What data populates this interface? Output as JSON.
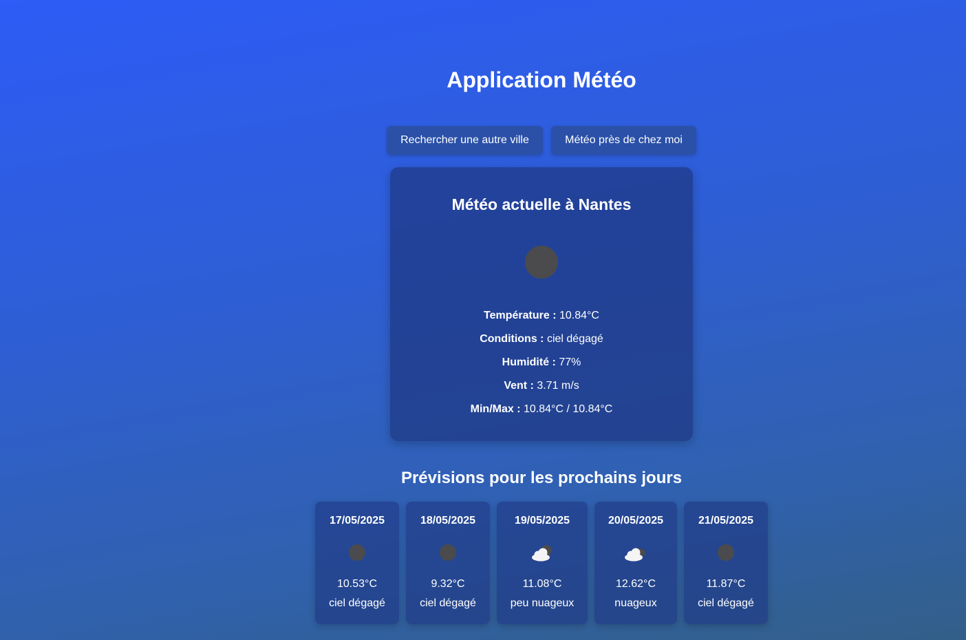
{
  "app": {
    "title": "Application Météo"
  },
  "actions": {
    "search_label": "Rechercher une autre ville",
    "near_label": "Météo près de chez moi"
  },
  "current": {
    "title": "Météo actuelle à Nantes",
    "icon": "clear-sky-icon",
    "details": [
      {
        "label": "Température :",
        "value": "10.84°C"
      },
      {
        "label": "Conditions :",
        "value": "ciel dégagé"
      },
      {
        "label": "Humidité :",
        "value": "77%"
      },
      {
        "label": "Vent :",
        "value": "3.71 m/s"
      },
      {
        "label": "Min/Max :",
        "value": "10.84°C / 10.84°C"
      }
    ]
  },
  "forecast": {
    "title": "Prévisions pour les prochains jours",
    "days": [
      {
        "date": "17/05/2025",
        "temp": "10.53°C",
        "desc": "ciel dégagé",
        "icon": "clear-sky-icon"
      },
      {
        "date": "18/05/2025",
        "temp": "9.32°C",
        "desc": "ciel dégagé",
        "icon": "clear-sky-icon"
      },
      {
        "date": "19/05/2025",
        "temp": "11.08°C",
        "desc": "peu nuageux",
        "icon": "few-clouds-icon"
      },
      {
        "date": "20/05/2025",
        "temp": "12.62°C",
        "desc": "nuageux",
        "icon": "cloudy-icon"
      },
      {
        "date": "21/05/2025",
        "temp": "11.87°C",
        "desc": "ciel dégagé",
        "icon": "clear-sky-icon"
      }
    ]
  },
  "colors": {
    "button_bg": "#2a50a8",
    "card_bg": "#23408f",
    "icon_dark": "#4b4b4d",
    "text": "#ffffff"
  }
}
